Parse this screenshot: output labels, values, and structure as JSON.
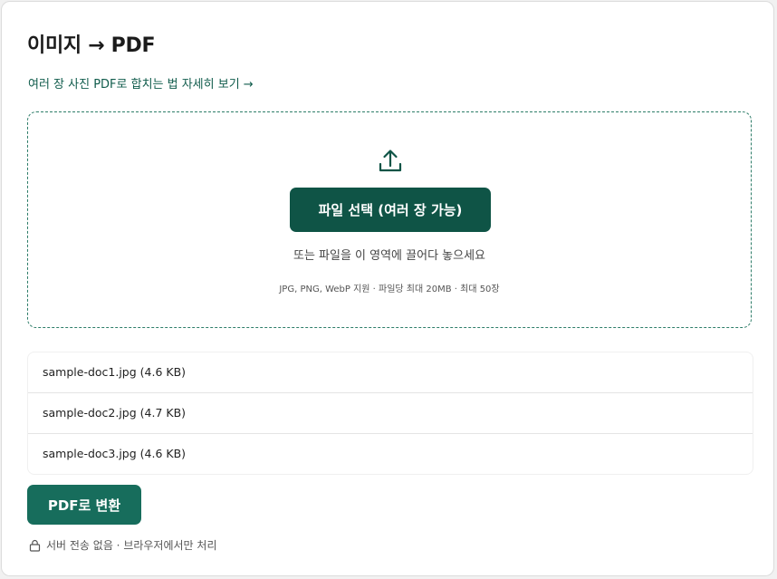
{
  "page": {
    "title": "이미지 → PDF",
    "guide_link": "여러 장 사진 PDF로 합치는 법 자세히 보기 →"
  },
  "dropzone": {
    "icon": "upload-icon",
    "select_button": "파일 선택 (여러 장 가능)",
    "hint": "또는 파일을 이 영역에 끌어다 놓으세요",
    "spec": "JPG, PNG, WebP 지원 · 파일당 최대 20MB · 최대 50장"
  },
  "files": [
    {
      "label": "sample-doc1.jpg (4.6 KB)"
    },
    {
      "label": "sample-doc2.jpg (4.7 KB)"
    },
    {
      "label": "sample-doc3.jpg (4.6 KB)"
    }
  ],
  "actions": {
    "convert_button": "PDF로 변환"
  },
  "footer": {
    "icon": "lock-icon",
    "privacy_note": "서버 전송 없음 · 브라우저에서만 처리"
  },
  "colors": {
    "accent": "#0f5446",
    "accent_light": "#176d5c",
    "link": "#0f5b4b",
    "dropzone_border": "#2e7d69"
  }
}
